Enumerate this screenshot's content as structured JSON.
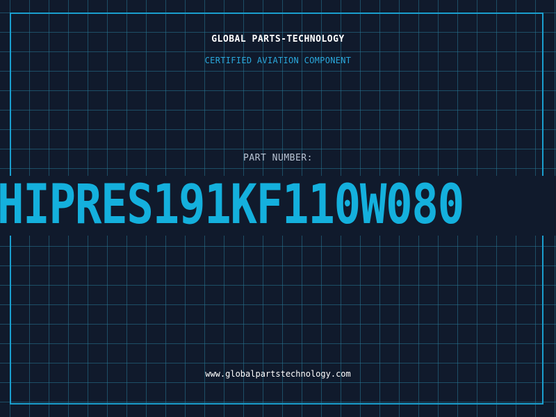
{
  "header": {
    "company": "GLOBAL PARTS-TECHNOLOGY",
    "subtitle": "CERTIFIED AVIATION COMPONENT"
  },
  "part": {
    "label": "PART NUMBER:",
    "number": "HIPRES191KF110W080"
  },
  "footer": {
    "website": "www.globalpartstechnology.com"
  },
  "colors": {
    "background": "#101a2c",
    "grid": "#28788f",
    "accent": "#14b0dd",
    "frame": "#1a9fcf"
  }
}
